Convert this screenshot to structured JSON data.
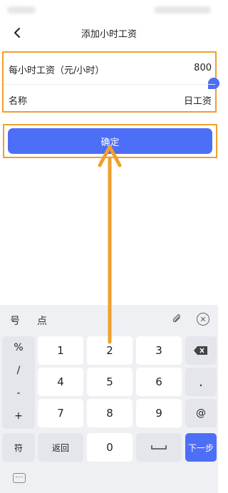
{
  "header": {
    "title": "添加小时工资",
    "back_icon": "chevron-left-icon"
  },
  "form": {
    "hourly_wage": {
      "label": "每小时工资（元/小时）",
      "value": "800"
    },
    "name": {
      "label": "名称",
      "value": "日工资"
    }
  },
  "confirm_label": "确定",
  "keyboard": {
    "suggestions": [
      "号",
      "点"
    ],
    "side_symbols": [
      "%",
      "/",
      "-",
      "+"
    ],
    "digits": [
      "1",
      "2",
      "3",
      "4",
      "5",
      "6",
      "7",
      "8",
      "9",
      "0"
    ],
    "keys": {
      "dot": ".",
      "at": "@",
      "symbols_label": "符",
      "back_label": "返回",
      "next_label": "下一步"
    }
  },
  "colors": {
    "accent": "#4d6ef7",
    "highlight": "#f0a02c"
  }
}
